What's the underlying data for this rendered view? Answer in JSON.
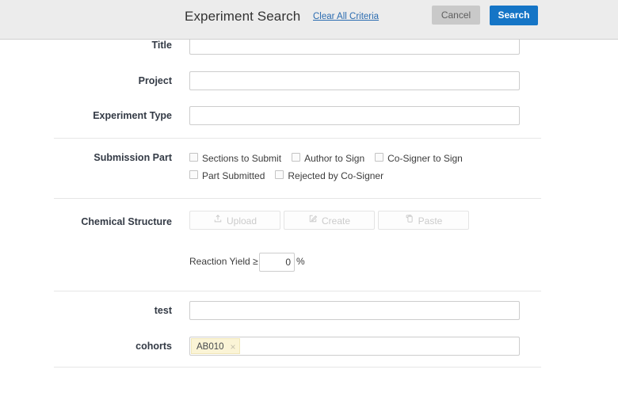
{
  "header": {
    "title": "Experiment Search",
    "clear_link": "Clear All Criteria",
    "cancel_label": "Cancel",
    "search_label": "Search",
    "accent_color": "#1575c6",
    "background_color": "#ececec",
    "link_color": "#2b6cb0"
  },
  "form": {
    "fields": [
      {
        "label": "Title",
        "value": "",
        "placeholder": ""
      },
      {
        "label": "Project",
        "value": "",
        "placeholder": ""
      },
      {
        "label": "Experiment Type",
        "value": "",
        "placeholder": ""
      }
    ],
    "submission_part": {
      "label": "Submission Part",
      "checkboxes_row1": [
        {
          "label": "Sections to Submit",
          "checked": false
        },
        {
          "label": "Author to Sign",
          "checked": false
        },
        {
          "label": "Co-Signer to Sign",
          "checked": false
        }
      ],
      "checkboxes_row2": [
        {
          "label": "Part Submitted",
          "checked": false
        },
        {
          "label": "Rejected by Co-Signer",
          "checked": false
        }
      ]
    },
    "chemical_structure": {
      "label": "Chemical Structure",
      "buttons": [
        {
          "label": "Upload",
          "icon": "upload-icon",
          "disabled": true
        },
        {
          "label": "Create",
          "icon": "pencil-square-icon",
          "disabled": true
        },
        {
          "label": "Paste",
          "icon": "clipboard-icon",
          "disabled": true
        }
      ],
      "reaction_yield": {
        "label": "Reaction Yield ≥",
        "value": "0",
        "unit": "%"
      }
    },
    "custom_fields": [
      {
        "label": "test",
        "value": "",
        "placeholder": ""
      }
    ],
    "cohorts": {
      "label": "cohorts",
      "tags": [
        {
          "text": "AB010",
          "remove_icon": "×"
        }
      ]
    }
  }
}
